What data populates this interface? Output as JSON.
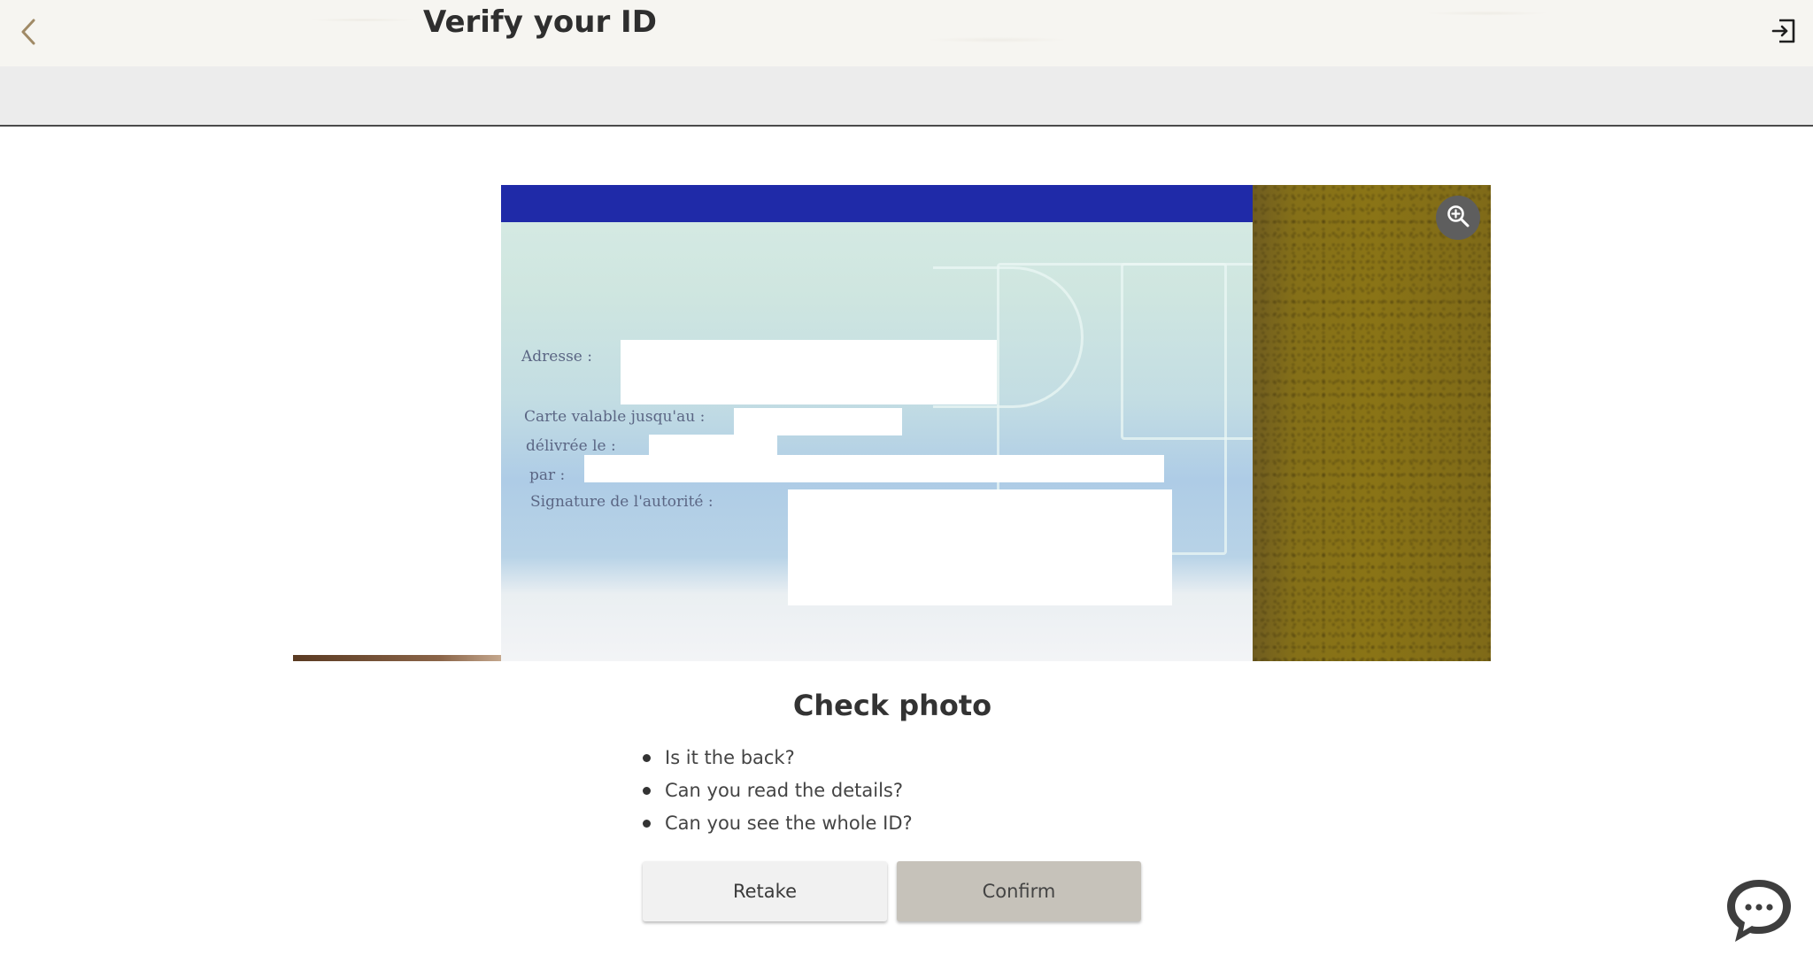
{
  "header": {
    "title": "Verify your ID",
    "back_icon": "chevron-left-icon",
    "exit_icon": "exit-icon"
  },
  "photo": {
    "labels": [
      "Adresse :",
      "Carte valable jusqu'au :",
      "délivrée le :",
      "par :",
      "Signature de l'autorité :"
    ],
    "zoom_icon": "zoom-in-icon"
  },
  "check": {
    "title": "Check photo",
    "items": [
      "Is it the back?",
      "Can you read the details?",
      "Can you see the whole ID?"
    ]
  },
  "actions": {
    "retake_label": "Retake",
    "confirm_label": "Confirm"
  },
  "chat": {
    "icon": "chat-bubble-icon"
  },
  "colors": {
    "header_bg": "#f6f5f1",
    "subbar_bg": "#ececec",
    "confirm_bg": "#c6c2ba",
    "retake_bg": "#f1f1f1",
    "icon_gold": "#a08a66"
  }
}
